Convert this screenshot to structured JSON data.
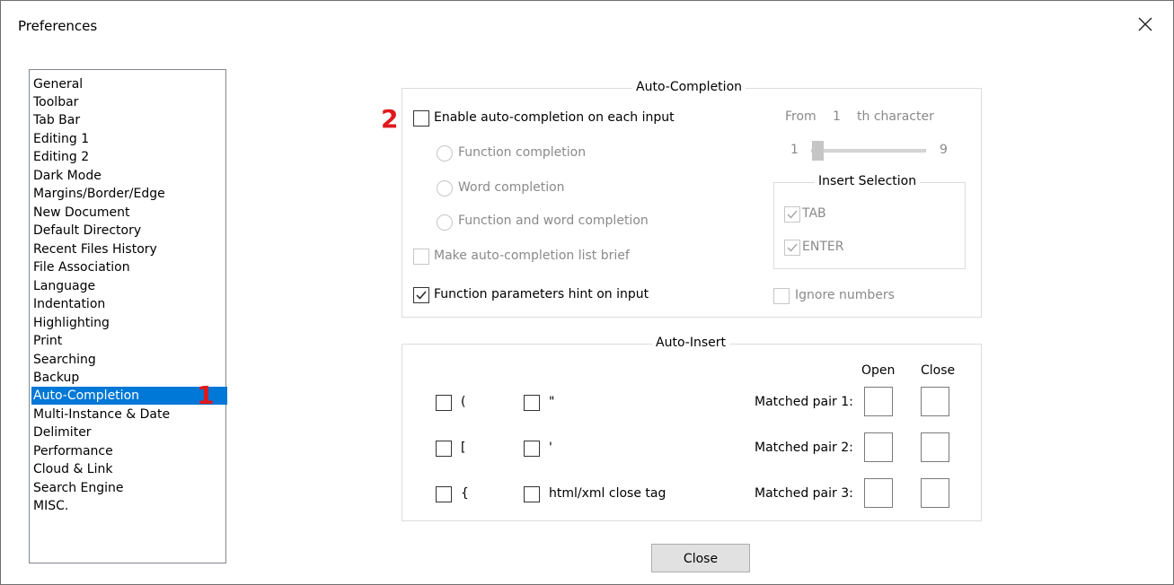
{
  "window": {
    "title": "Preferences"
  },
  "nav": {
    "items": [
      {
        "label": "General"
      },
      {
        "label": "Toolbar"
      },
      {
        "label": "Tab Bar"
      },
      {
        "label": "Editing 1"
      },
      {
        "label": "Editing 2"
      },
      {
        "label": "Dark Mode"
      },
      {
        "label": "Margins/Border/Edge"
      },
      {
        "label": "New Document"
      },
      {
        "label": "Default Directory"
      },
      {
        "label": "Recent Files History"
      },
      {
        "label": "File Association"
      },
      {
        "label": "Language"
      },
      {
        "label": "Indentation"
      },
      {
        "label": "Highlighting"
      },
      {
        "label": "Print"
      },
      {
        "label": "Searching"
      },
      {
        "label": "Backup"
      },
      {
        "label": "Auto-Completion",
        "selected": true
      },
      {
        "label": "Multi-Instance & Date"
      },
      {
        "label": "Delimiter"
      },
      {
        "label": "Performance"
      },
      {
        "label": "Cloud & Link"
      },
      {
        "label": "Search Engine"
      },
      {
        "label": "MISC."
      }
    ]
  },
  "markers": {
    "one": "1",
    "two": "2"
  },
  "auto_completion": {
    "group_title": "Auto-Completion",
    "enable_label": "Enable auto-completion on each input",
    "enable_checked": false,
    "from_label": "From",
    "from_value": "1",
    "th_character_label": "th character",
    "slider_min": "1",
    "slider_max": "9",
    "slider_value": 1,
    "radio_function": "Function completion",
    "radio_word": "Word completion",
    "radio_both": "Function and word completion",
    "brief_label": "Make auto-completion list brief",
    "hint_label": "Function parameters hint on input",
    "hint_checked": true,
    "insert_selection_title": "Insert Selection",
    "tab_label": "TAB",
    "tab_checked": true,
    "enter_label": "ENTER",
    "enter_checked": true,
    "ignore_numbers_label": "Ignore numbers"
  },
  "auto_insert": {
    "group_title": "Auto-Insert",
    "open_label": "Open",
    "close_label": "Close",
    "paren_label": "(",
    "bracket_label": "[",
    "brace_label": "{",
    "dquote_label": "\"",
    "squote_label": "'",
    "htmlxml_label": "html/xml close tag",
    "pair1_label": "Matched pair 1:",
    "pair2_label": "Matched pair 2:",
    "pair3_label": "Matched pair 3:"
  },
  "buttons": {
    "close_label": "Close"
  },
  "icons": {
    "close": "close-icon",
    "check": "check-icon"
  },
  "colors": {
    "selection": "#0078d7",
    "marker": "#e0191c"
  }
}
